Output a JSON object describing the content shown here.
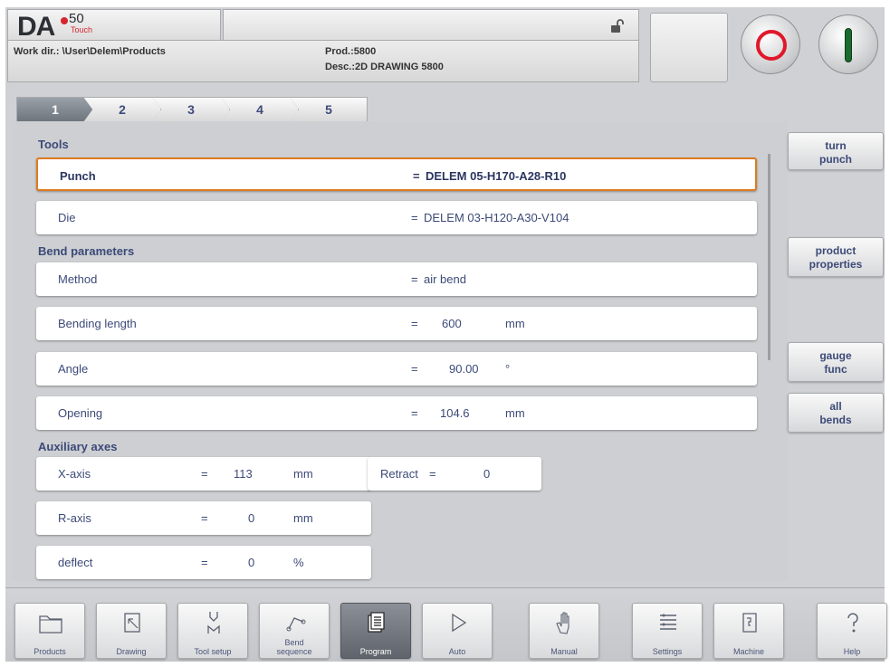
{
  "header": {
    "logo_text": "DA",
    "logo_number": "50",
    "logo_sub": "Touch",
    "workdir": "Work dir.: \\User\\Delem\\Products",
    "product": "Prod.:5800",
    "description": "Desc.:2D DRAWING 5800"
  },
  "tabs": [
    "1",
    "2",
    "3",
    "4",
    "5"
  ],
  "active_tab": "1",
  "sections": {
    "tools": "Tools",
    "bend": "Bend parameters",
    "aux": "Auxiliary axes"
  },
  "rows": {
    "punch": {
      "label": "Punch",
      "eq": "=",
      "value": "DELEM 05-H170-A28-R10"
    },
    "die": {
      "label": "Die",
      "eq": "=",
      "value": "DELEM 03-H120-A30-V104"
    },
    "method": {
      "label": "Method",
      "eq": "=",
      "value": "air bend"
    },
    "bending_length": {
      "label": "Bending length",
      "eq": "=",
      "value": "600",
      "unit": "mm"
    },
    "angle": {
      "label": "Angle",
      "eq": "=",
      "value": "90.00",
      "unit": "°"
    },
    "opening": {
      "label": "Opening",
      "eq": "=",
      "value": "104.6",
      "unit": "mm"
    },
    "x_axis": {
      "label": "X-axis",
      "eq": "=",
      "value": "113",
      "unit": "mm"
    },
    "retract": {
      "label": "Retract",
      "eq": "=",
      "value": "0"
    },
    "r_axis": {
      "label": "R-axis",
      "eq": "=",
      "value": "0",
      "unit": "mm"
    },
    "deflect": {
      "label": "deflect",
      "eq": "=",
      "value": "0",
      "unit": "%"
    }
  },
  "side_buttons": {
    "turn_punch": [
      "turn",
      "punch"
    ],
    "product_properties": [
      "product",
      "properties"
    ],
    "gauge_func": [
      "gauge",
      "func"
    ],
    "all_bends": [
      "all",
      "bends"
    ]
  },
  "nav": {
    "products": "Products",
    "drawing": "Drawing",
    "tool_setup": "Tool setup",
    "bend_sequence_1": "Bend",
    "bend_sequence_2": "sequence",
    "program": "Program",
    "auto": "Auto",
    "manual": "Manual",
    "settings": "Settings",
    "machine": "Machine",
    "help": "Help"
  },
  "colors": {
    "accent_red": "#d6262d",
    "selection_orange": "#e07a1f",
    "label_blue": "#3c4a78",
    "start_green": "#1b6a2e"
  },
  "icons": {
    "lock": "unlocked-padlock-icon",
    "stop": "stop-icon",
    "start": "start-icon"
  }
}
